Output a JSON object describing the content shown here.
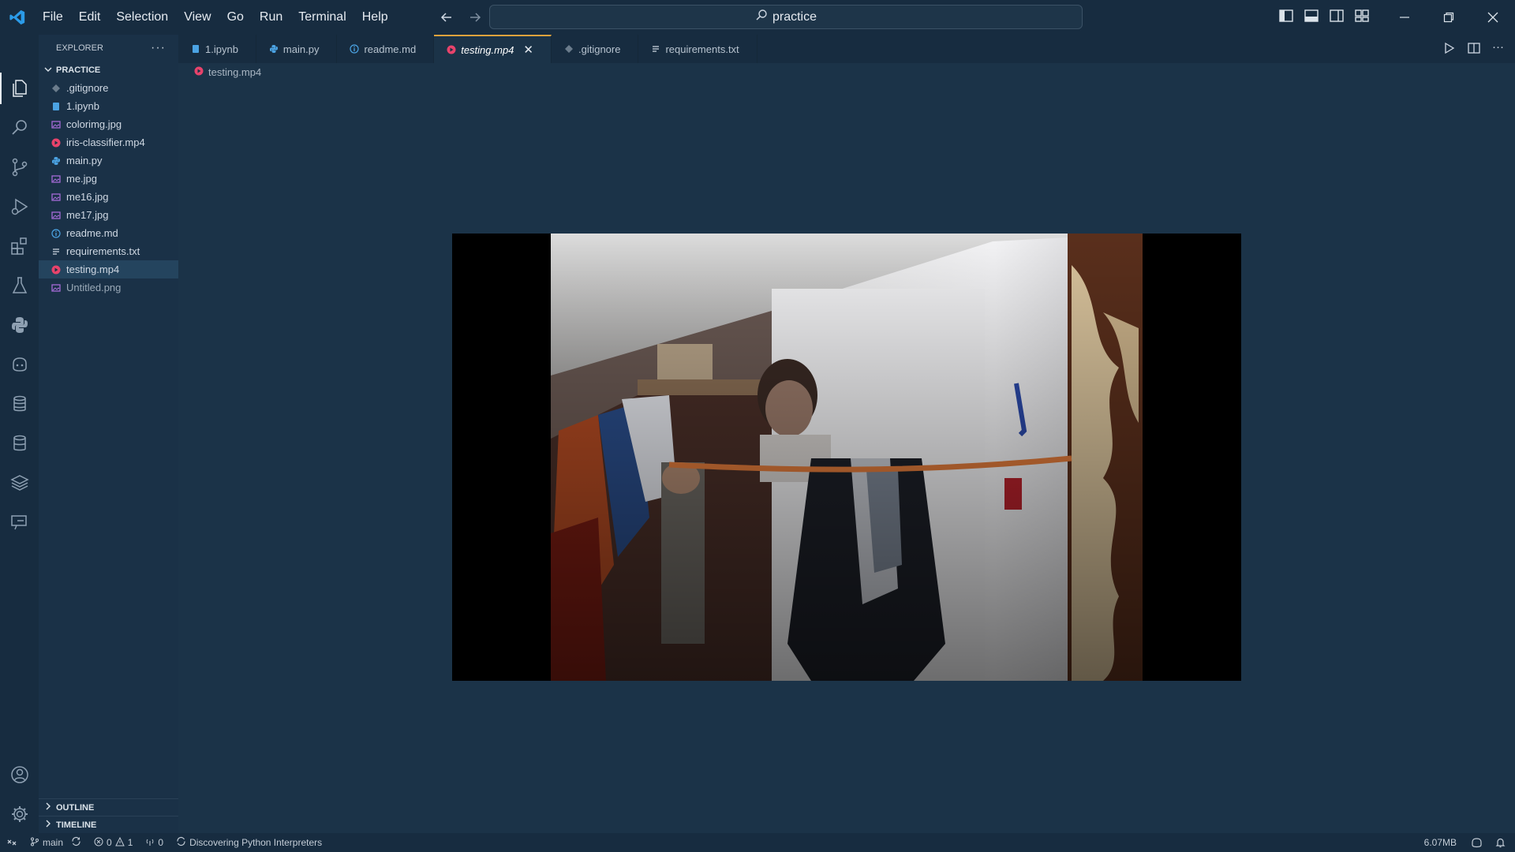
{
  "window": {
    "search_text": "practice",
    "menu": [
      "File",
      "Edit",
      "Selection",
      "View",
      "Go",
      "Run",
      "Terminal",
      "Help"
    ]
  },
  "explorer": {
    "header": "EXPLORER",
    "folder": "PRACTICE",
    "files": [
      {
        "name": ".gitignore",
        "icon": "git-diamond-icon",
        "color": "#6b7c8c"
      },
      {
        "name": "1.ipynb",
        "icon": "notebook-icon",
        "color": "#4ba3e3"
      },
      {
        "name": "colorimg.jpg",
        "icon": "image-icon",
        "color": "#a46bd6"
      },
      {
        "name": "iris-classifier.mp4",
        "icon": "video-icon",
        "color": "#e8436b"
      },
      {
        "name": "main.py",
        "icon": "python-icon",
        "color": "#4ba3e3"
      },
      {
        "name": "me.jpg",
        "icon": "image-icon",
        "color": "#a46bd6"
      },
      {
        "name": "me16.jpg",
        "icon": "image-icon",
        "color": "#a46bd6"
      },
      {
        "name": "me17.jpg",
        "icon": "image-icon",
        "color": "#a46bd6"
      },
      {
        "name": "readme.md",
        "icon": "info-icon",
        "color": "#4ba3e3"
      },
      {
        "name": "requirements.txt",
        "icon": "lines-icon",
        "color": "#cfd8e3"
      },
      {
        "name": "testing.mp4",
        "icon": "video-icon",
        "color": "#e8436b"
      },
      {
        "name": "Untitled.png",
        "icon": "image-icon",
        "color": "#a46bd6"
      }
    ],
    "outline": "OUTLINE",
    "timeline": "TIMELINE"
  },
  "tabs": [
    {
      "label": "1.ipynb",
      "icon": "notebook-icon",
      "color": "#4ba3e3"
    },
    {
      "label": "main.py",
      "icon": "python-icon",
      "color": "#4ba3e3"
    },
    {
      "label": "readme.md",
      "icon": "info-icon",
      "color": "#4ba3e3"
    },
    {
      "label": "testing.mp4",
      "icon": "video-icon",
      "color": "#e8436b"
    },
    {
      "label": ".gitignore",
      "icon": "git-diamond-icon",
      "color": "#6b7c8c"
    },
    {
      "label": "requirements.txt",
      "icon": "lines-icon",
      "color": "#cfd8e3"
    }
  ],
  "breadcrumb": "testing.mp4",
  "status": {
    "branch": "main",
    "errors": "0",
    "warnings": "1",
    "ports": "0",
    "task": "Discovering Python Interpreters",
    "memory": "6.07MB"
  },
  "accent_color": "#e0a23c"
}
